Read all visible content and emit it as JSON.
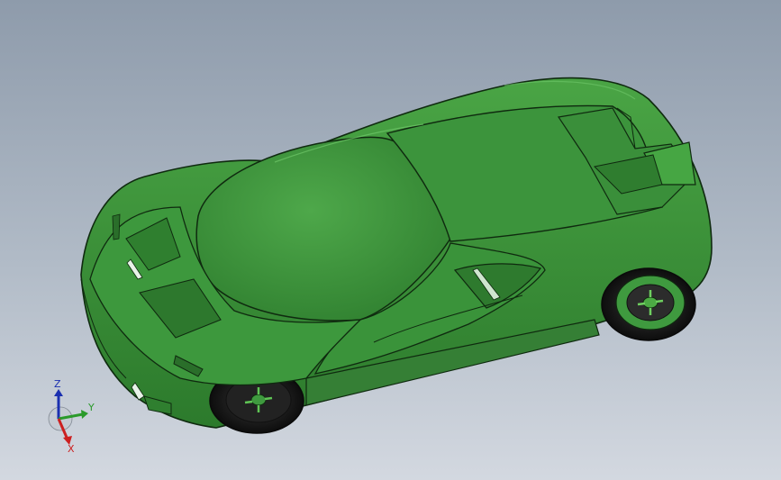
{
  "triad": {
    "z_label": "Z",
    "y_label": "Y",
    "x_label": "X"
  },
  "colors": {
    "body": "#3f9a3f",
    "body_dark": "#2a6e2a",
    "body_light": "#5fbf55",
    "edge": "#0f2a0f",
    "tire": "#1a1a1a",
    "axis_x": "#cc2020",
    "axis_y": "#2a9a2a",
    "axis_z": "#1a2fb0"
  }
}
